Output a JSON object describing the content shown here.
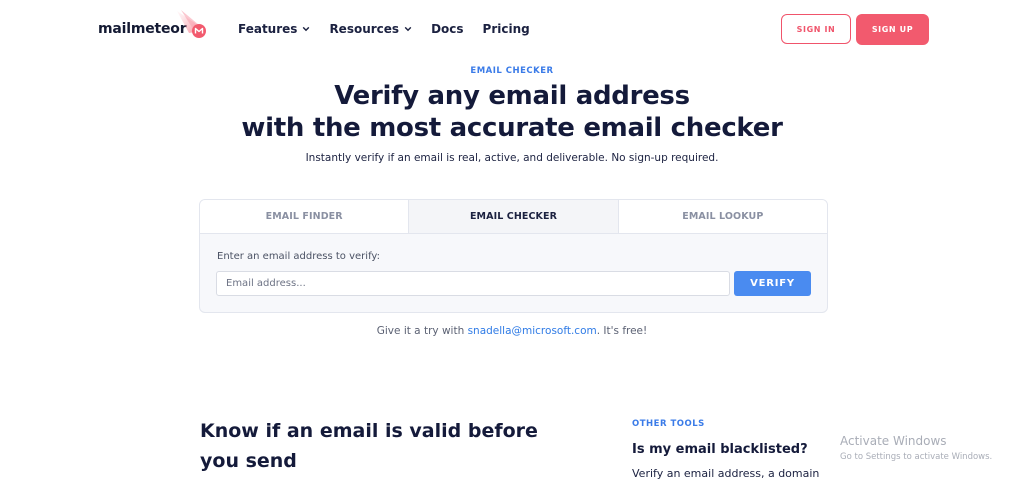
{
  "brand": {
    "name": "mailmeteor",
    "accent": "#f25a6e",
    "link_color": "#3a7be8"
  },
  "nav": {
    "items": [
      {
        "label": "Features",
        "has_dropdown": true
      },
      {
        "label": "Resources",
        "has_dropdown": true
      },
      {
        "label": "Docs",
        "has_dropdown": false
      },
      {
        "label": "Pricing",
        "has_dropdown": false
      }
    ],
    "sign_in": "SIGN IN",
    "sign_up": "SIGN UP"
  },
  "hero": {
    "eyebrow": "EMAIL CHECKER",
    "title_line1": "Verify any email address",
    "title_line2": "with the most accurate email checker",
    "subtitle": "Instantly verify if an email is real, active, and deliverable. No sign-up required."
  },
  "tool_card": {
    "tabs": [
      {
        "label": "EMAIL FINDER",
        "active": false
      },
      {
        "label": "EMAIL CHECKER",
        "active": true
      },
      {
        "label": "EMAIL LOOKUP",
        "active": false
      }
    ],
    "field_label": "Enter an email address to verify:",
    "input_placeholder": "Email address...",
    "input_value": "",
    "verify_label": "VERIFY"
  },
  "try_line": {
    "prefix": "Give it a try with ",
    "example": "snadella@microsoft.com",
    "suffix": ". It's free!"
  },
  "lower": {
    "heading": "Know if an email is valid before you send",
    "other_tools_label": "OTHER TOOLS",
    "tool_title": "Is my email blacklisted?",
    "tool_desc": "Verify an email address, a domain"
  },
  "watermark": {
    "title": "Activate Windows",
    "subtitle": "Go to Settings to activate Windows."
  }
}
